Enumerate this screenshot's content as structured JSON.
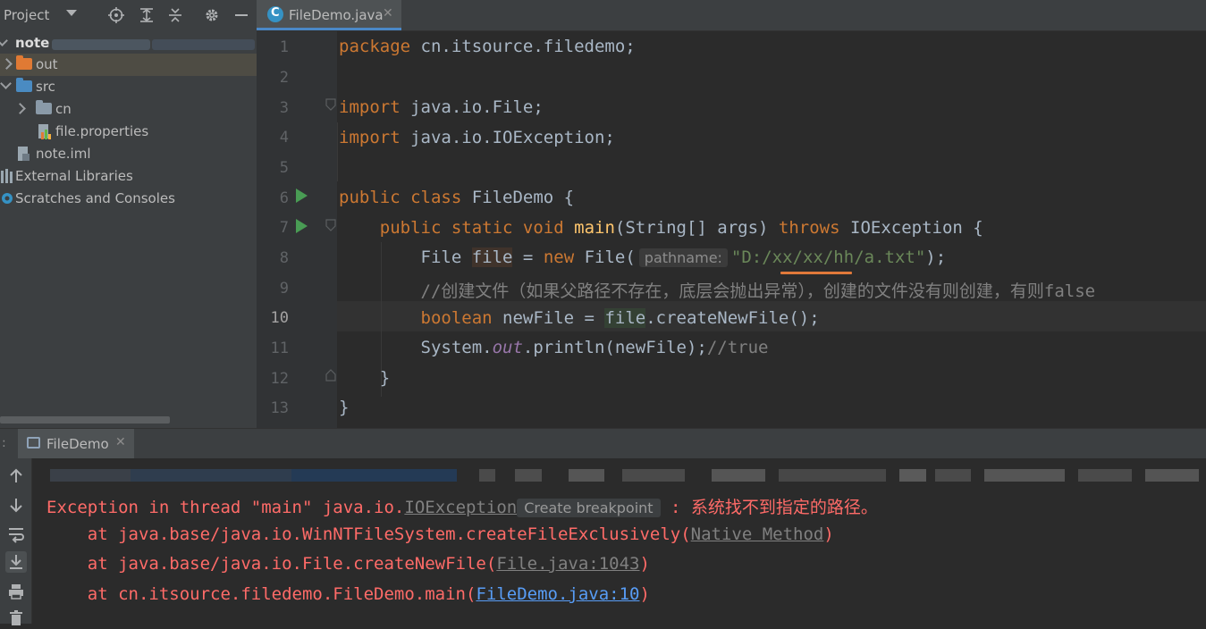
{
  "project_panel": {
    "title": "Project",
    "tree": [
      {
        "label": "note"
      },
      {
        "label": "out"
      },
      {
        "label": "src"
      },
      {
        "label": "cn"
      },
      {
        "label": "file.properties"
      },
      {
        "label": "note.iml"
      },
      {
        "label": "External Libraries"
      },
      {
        "label": "Scratches and Consoles"
      }
    ]
  },
  "editor": {
    "tab_label": "FileDemo.java",
    "current_line": 10,
    "line_numbers": [
      "1",
      "2",
      "3",
      "4",
      "5",
      "6",
      "7",
      "8",
      "9",
      "10",
      "11",
      "12",
      "13"
    ],
    "code": {
      "l1_kw": "package",
      "l1_rest": " cn.itsource.filedemo;",
      "l3_kw": "import",
      "l3_rest": " java.io.File;",
      "l4_kw": "import",
      "l4_rest": " java.io.IOException;",
      "l6_kw": "public class",
      "l6_rest": " FileDemo {",
      "l7_kw": "public static void",
      "l7_fn": "main",
      "l7_mid": "(String[] args) ",
      "l7_throws": "throws",
      "l7_rest": " IOException {",
      "l8_type": "File ",
      "l8_var": "file",
      "l8_eq": " = ",
      "l8_new": "new",
      "l8_ctor": " File(",
      "l8_hint": "pathname:",
      "l8_str": "\"D:/xx/xx/hh/a.txt\"",
      "l8_end": ");",
      "l9_comment": "//创建文件（如果父路径不存在，底层会抛出异常），创建的文件没有则创建，有则false",
      "l10_kw": "boolean",
      "l10_mid": " newFile = ",
      "l10_var": "file",
      "l10_rest": ".createNewFile();",
      "l11_a": "System.",
      "l11_out": "out",
      "l11_b": ".println(newFile);",
      "l11_cmt": "//true",
      "l12": "}",
      "l13": "}"
    }
  },
  "run_panel": {
    "tab_label": "FileDemo",
    "console": {
      "line1_a": "Exception in thread \"main\" java.io.",
      "line1_link": "IOException",
      "line1_tooltip": "Create breakpoint",
      "line1_b": " : 系统找不到指定的路径。",
      "line2_a": "    at java.base/java.io.WinNTFileSystem.createFileExclusively(",
      "line2_link": "Native Method",
      "line2_b": ")",
      "line3_a": "    at java.base/java.io.File.createNewFile(",
      "line3_link": "File.java:1043",
      "line3_b": ")",
      "line4_a": "    at cn.itsource.filedemo.FileDemo.main(",
      "line4_link": "FileDemo.java:10",
      "line4_b": ")"
    }
  },
  "colors": {
    "accent": "#4a88c7",
    "error_text": "#ff6b68",
    "keyword": "#cc7832",
    "string": "#6a8759",
    "run_green": "#499c54",
    "folder_orange": "#e07a34",
    "folder_blue": "#4a8bc2"
  }
}
